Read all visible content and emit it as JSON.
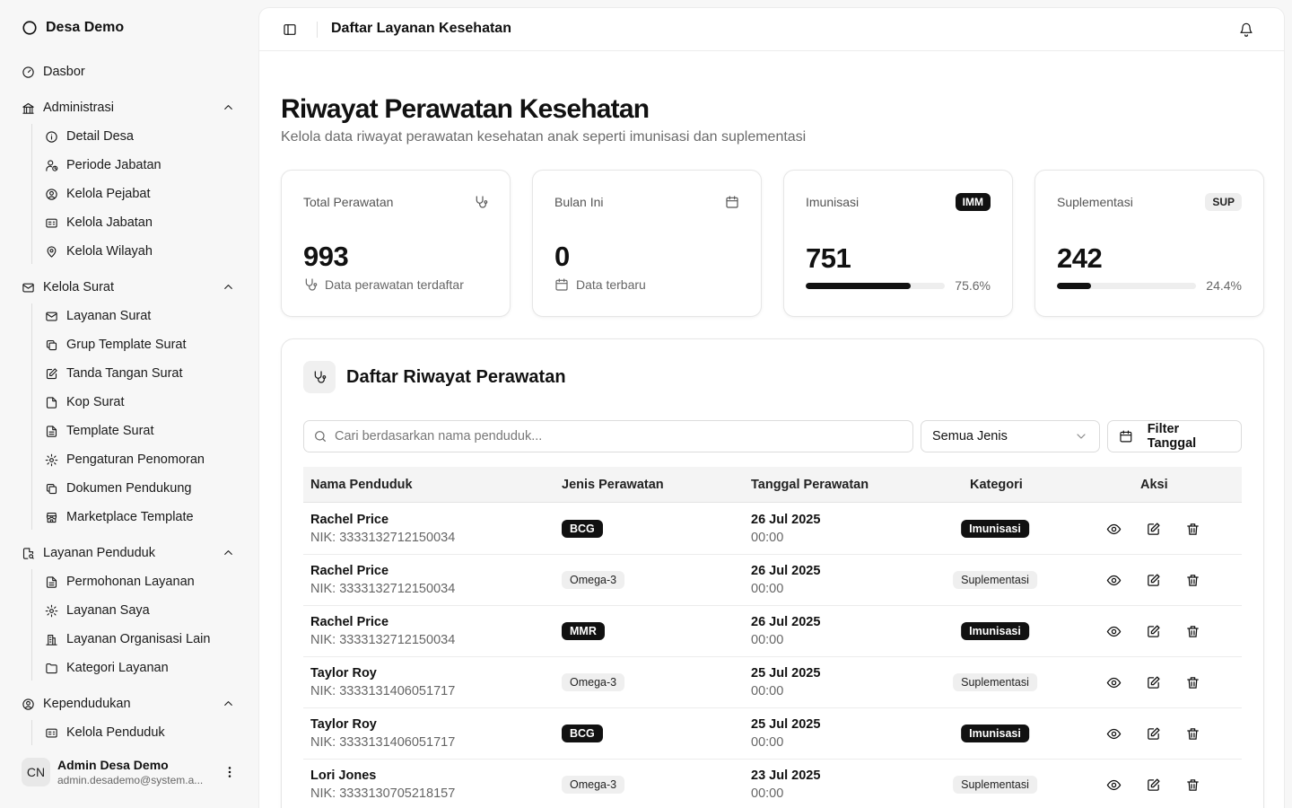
{
  "sidebar": {
    "brand": "Desa Demo",
    "dashboard": "Dasbor",
    "groups": [
      {
        "label": "Administrasi",
        "items": [
          "Detail Desa",
          "Periode Jabatan",
          "Kelola Pejabat",
          "Kelola Jabatan",
          "Kelola Wilayah"
        ]
      },
      {
        "label": "Kelola Surat",
        "items": [
          "Layanan Surat",
          "Grup Template Surat",
          "Tanda Tangan Surat",
          "Kop Surat",
          "Template Surat",
          "Pengaturan Penomoran",
          "Dokumen Pendukung",
          "Marketplace Template"
        ]
      },
      {
        "label": "Layanan Penduduk",
        "items": [
          "Permohonan Layanan",
          "Layanan Saya",
          "Layanan Organisasi Lain",
          "Kategori Layanan"
        ]
      },
      {
        "label": "Kependudukan",
        "items": [
          "Kelola Penduduk"
        ]
      }
    ],
    "user": {
      "initials": "CN",
      "name": "Admin Desa Demo",
      "email": "admin.desademo@system.a..."
    }
  },
  "header": {
    "title": "Daftar Layanan Kesehatan"
  },
  "page": {
    "title": "Riwayat Perawatan Kesehatan",
    "subtitle": "Kelola data riwayat perawatan kesehatan anak seperti imunisasi dan suplementasi"
  },
  "stats": {
    "total": {
      "label": "Total Perawatan",
      "value": "993",
      "note": "Data perawatan terdaftar"
    },
    "month": {
      "label": "Bulan Ini",
      "value": "0",
      "note": "Data terbaru"
    },
    "imunisasi": {
      "label": "Imunisasi",
      "badge": "IMM",
      "value": "751",
      "percent_label": "75.6%",
      "percent": 0.756
    },
    "suplementasi": {
      "label": "Suplementasi",
      "badge": "SUP",
      "value": "242",
      "percent_label": "24.4%",
      "percent": 0.244
    }
  },
  "table_panel": {
    "title": "Daftar Riwayat Perawatan",
    "search_placeholder": "Cari berdasarkan nama penduduk...",
    "type_filter": "Semua Jenis",
    "date_filter": "Filter Tanggal",
    "columns": [
      "Nama Penduduk",
      "Jenis Perawatan",
      "Tanggal Perawatan",
      "Kategori",
      "Aksi"
    ],
    "rows": [
      {
        "name": "Rachel Price",
        "nik": "NIK: 3333132712150034",
        "jenis": "BCG",
        "date": "26 Jul 2025",
        "time": "00:00",
        "kategori": "Imunisasi"
      },
      {
        "name": "Rachel Price",
        "nik": "NIK: 3333132712150034",
        "jenis": "Omega-3",
        "date": "26 Jul 2025",
        "time": "00:00",
        "kategori": "Suplementasi"
      },
      {
        "name": "Rachel Price",
        "nik": "NIK: 3333132712150034",
        "jenis": "MMR",
        "date": "26 Jul 2025",
        "time": "00:00",
        "kategori": "Imunisasi"
      },
      {
        "name": "Taylor Roy",
        "nik": "NIK: 3333131406051717",
        "jenis": "Omega-3",
        "date": "25 Jul 2025",
        "time": "00:00",
        "kategori": "Suplementasi"
      },
      {
        "name": "Taylor Roy",
        "nik": "NIK: 3333131406051717",
        "jenis": "BCG",
        "date": "25 Jul 2025",
        "time": "00:00",
        "kategori": "Imunisasi"
      },
      {
        "name": "Lori Jones",
        "nik": "NIK: 3333130705218157",
        "jenis": "Omega-3",
        "date": "23 Jul 2025",
        "time": "00:00",
        "kategori": "Suplementasi"
      }
    ]
  },
  "icons": {
    "brand": "circle-logo-icon",
    "dashboard": "gauge-icon",
    "administrasi": "landmark-icon",
    "kelola_surat": "mail-icon",
    "layanan_penduduk": "file-search-icon",
    "kependudukan": "user-circle-icon",
    "view": "eye-icon",
    "edit": "edit-icon",
    "delete": "trash-icon"
  },
  "colors": {
    "accent": "#111111",
    "muted": "#666666",
    "surface": "#f7f7f7"
  }
}
